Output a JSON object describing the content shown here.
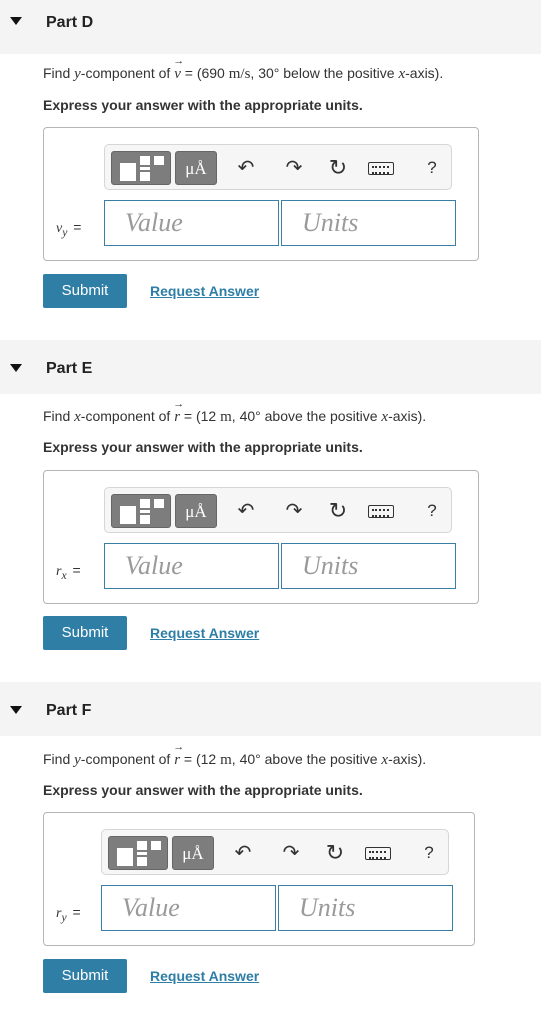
{
  "icons": {
    "undo": "↶",
    "redo": "↷",
    "reset": "↻",
    "help": "?",
    "units_symbol": "μÅ"
  },
  "parts": [
    {
      "title": "Part D",
      "prompt_prefix": "Find ",
      "prompt_comp": "y",
      "prompt_mid": "-component of ",
      "prompt_vec": "v",
      "prompt_eq": " = (690 ",
      "prompt_units": "m/s",
      "prompt_rest": ", 30° below the positive ",
      "prompt_axis": "x",
      "prompt_end": "-axis).",
      "instruction": "Express your answer with the appropriate units.",
      "var_label": "v",
      "var_sub": "y",
      "value_placeholder": "Value",
      "units_placeholder": "Units",
      "submit_label": "Submit",
      "request_label": "Request Answer"
    },
    {
      "title": "Part E",
      "prompt_prefix": "Find ",
      "prompt_comp": "x",
      "prompt_mid": "-component of ",
      "prompt_vec": "r",
      "prompt_eq": " = (12 ",
      "prompt_units": "m",
      "prompt_rest": ", 40° above the positive ",
      "prompt_axis": "x",
      "prompt_end": "-axis).",
      "instruction": "Express your answer with the appropriate units.",
      "var_label": "r",
      "var_sub": "x",
      "value_placeholder": "Value",
      "units_placeholder": "Units",
      "submit_label": "Submit",
      "request_label": "Request Answer"
    },
    {
      "title": "Part F",
      "prompt_prefix": "Find ",
      "prompt_comp": "y",
      "prompt_mid": "-component of ",
      "prompt_vec": "r",
      "prompt_eq": " = (12 ",
      "prompt_units": "m",
      "prompt_rest": ", 40° above the positive ",
      "prompt_axis": "x",
      "prompt_end": "-axis).",
      "instruction": "Express your answer with the appropriate units.",
      "var_label": "r",
      "var_sub": "y",
      "value_placeholder": "Value",
      "units_placeholder": "Units",
      "submit_label": "Submit",
      "request_label": "Request Answer"
    }
  ]
}
